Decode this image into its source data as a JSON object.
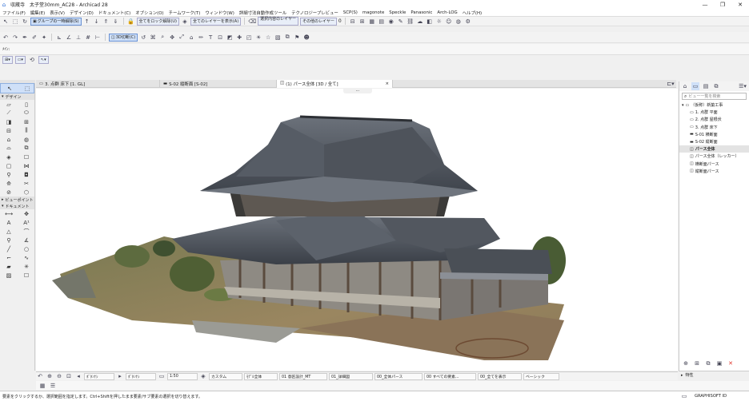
{
  "window": {
    "app_icon": "archicad-logo",
    "title": "収蔵寺　太子堂30mm_AC28 - Archicad 28",
    "minimize": "—",
    "maximize": "❐",
    "close": "✕"
  },
  "menu": [
    "ファイル(F)",
    "編集(E)",
    "表示(V)",
    "デザイン(D)",
    "ドキュメント(C)",
    "オプション(O)",
    "チームワーク(T)",
    "ウィンドウ(W)",
    "詳細寸法自動作成ツール",
    "テクノロジープレビュー",
    "SCP(S)",
    "magonote",
    "Speckle",
    "Panasonic",
    "Arch-LOG",
    "ヘルプ(H)"
  ],
  "toolbar1": {
    "group_release": "グループの一時解除(S)",
    "lock_all": "全てをロック解除(U)",
    "show_all_layers": "全てのレイヤーを表示(A)",
    "selection_layer": "選択内容のレイヤー",
    "other_layer": "その他のレイヤー",
    "count": "0"
  },
  "toolbar2": {
    "view_3d": "3D切断(C)"
  },
  "infobox": {
    "label": "ﾒｲﾝ:"
  },
  "tabs": [
    {
      "label": "3. 点群  床下 [1. GL]",
      "icon": "floorplan-icon"
    },
    {
      "label": "S-02 縦断面 [S-02]",
      "icon": "section-icon"
    },
    {
      "label": "(1) パース全体 [3D / 全て]",
      "icon": "3d-icon"
    }
  ],
  "tab_close": "×",
  "toolbox": {
    "sections": [
      "デザイン",
      "ビューポイント",
      "ドキュメント"
    ]
  },
  "navigator": {
    "search_placeholder": "ビュー一覧を検索",
    "root": "（仮称）新築工事",
    "items": [
      "1. 点群  平面",
      "2. 点群  屋根伏",
      "3. 点群  床下",
      "S-01 横断面",
      "S-02 縦断面",
      "パース全体",
      "パース全体（レッカー）",
      "横断面パース",
      "縦断面パース"
    ],
    "selected": 5,
    "properties": "特性"
  },
  "bottom": {
    "undo_label": "ﾎﾞﾀﾝﾅｼ",
    "redo_label": "ﾎﾞﾀﾝﾅｼ",
    "scale": "1:50",
    "custom": "カスタム",
    "model": "ﾓﾃﾞﾙ全体",
    "layer": "01 意匠設計_MT",
    "pen": "01_詳細図",
    "override": "00_全体パース",
    "renovation": "00 すべての要素...",
    "partial": "00_全てを表示",
    "base": "ベーシック"
  },
  "status": {
    "hint": "要素をクリックするか、選択範囲を指定します。Ctrl+Shiftを押したまま要素/サブ要素の選択を切り替えます。",
    "brand": "GRAPHISOFT ID"
  },
  "colors": {
    "accent": "#2f6fd6",
    "close": "#e0352b",
    "sky": "#ffffff"
  }
}
